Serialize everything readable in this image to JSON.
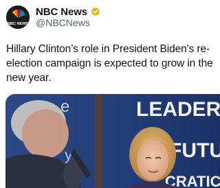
{
  "tweet": {
    "author": {
      "display_name": "NBC News",
      "handle": "@NBCNews",
      "verified": true,
      "avatar_text": "NBC NEWS",
      "avatar_icon": "nbc-peacock-logo"
    },
    "text": "Hillary Clinton’s role in President Biden's re-election campaign is expected to grow in the new year.",
    "media": {
      "type": "photo",
      "banner_lines": [
        "LEADERSH",
        "FUTU",
        "CRATIC"
      ],
      "partial_letters": [
        "e",
        "y"
      ]
    }
  },
  "colors": {
    "verified_badge": "#e2b719",
    "handle_gray": "#536471",
    "banner_blue": "#1f3a73"
  }
}
